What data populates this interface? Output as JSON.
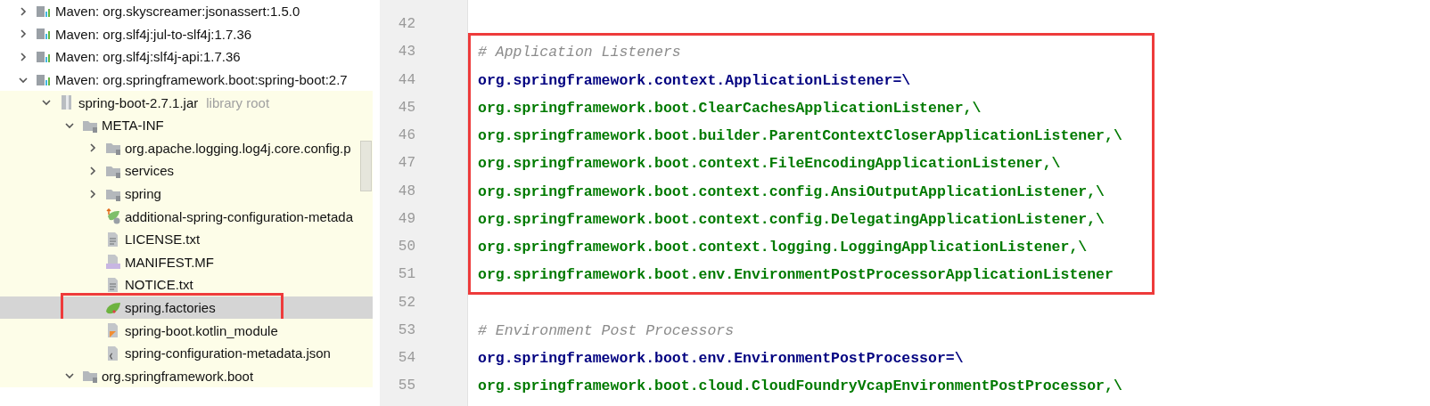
{
  "project_tree": [
    {
      "label": "Maven: org.skyscreamer:jsonassert:1.5.0",
      "kind": "maven",
      "expanded": false
    },
    {
      "label": "Maven: org.slf4j:jul-to-slf4j:1.7.36",
      "kind": "maven",
      "expanded": false
    },
    {
      "label": "Maven: org.slf4j:slf4j-api:1.7.36",
      "kind": "maven",
      "expanded": false
    },
    {
      "label": "Maven: org.springframework.boot:spring-boot:2.7",
      "kind": "maven",
      "expanded": true,
      "children": [
        {
          "label": "spring-boot-2.7.1.jar",
          "hint": "library root",
          "kind": "jar",
          "expanded": true,
          "scoped": true,
          "children": [
            {
              "label": "META-INF",
              "kind": "folder",
              "expanded": true,
              "children": [
                {
                  "label": "org.apache.logging.log4j.core.config.p",
                  "kind": "folder",
                  "expanded": false
                },
                {
                  "label": "services",
                  "kind": "folder",
                  "expanded": false
                },
                {
                  "label": "spring",
                  "kind": "folder",
                  "expanded": false
                },
                {
                  "label": "additional-spring-configuration-metada",
                  "kind": "meta",
                  "selected": false,
                  "annotated": false
                },
                {
                  "label": "LICENSE.txt",
                  "kind": "text",
                  "selected": false,
                  "annotated": false
                },
                {
                  "label": "MANIFEST.MF",
                  "kind": "manifest",
                  "selected": false,
                  "annotated": false
                },
                {
                  "label": "NOTICE.txt",
                  "kind": "text",
                  "selected": false,
                  "annotated": false
                },
                {
                  "label": "spring.factories",
                  "kind": "spring",
                  "selected": true,
                  "annotated": true
                },
                {
                  "label": "spring-boot.kotlin_module",
                  "kind": "kotlin",
                  "selected": false,
                  "annotated": false
                },
                {
                  "label": "spring-configuration-metadata.json",
                  "kind": "json",
                  "selected": false,
                  "annotated": false
                }
              ]
            },
            {
              "label": "org.springframework.boot",
              "kind": "folder",
              "expanded": true
            }
          ]
        }
      ]
    }
  ],
  "editor": {
    "blocks": [
      {
        "boxed": false,
        "lines": [
          {
            "number": "42",
            "kind": "blank"
          }
        ]
      },
      {
        "boxed": true,
        "lines": [
          {
            "number": "43",
            "kind": "comment",
            "text": "# Application Listeners"
          },
          {
            "number": "44",
            "kind": "key",
            "text": "org.springframework.context.ApplicationListener=\\"
          },
          {
            "number": "45",
            "kind": "value",
            "text": "org.springframework.boot.ClearCachesApplicationListener,\\"
          },
          {
            "number": "46",
            "kind": "value",
            "text": "org.springframework.boot.builder.ParentContextCloserApplicationListener,\\"
          },
          {
            "number": "47",
            "kind": "value",
            "text": "org.springframework.boot.context.FileEncodingApplicationListener,\\"
          },
          {
            "number": "48",
            "kind": "value",
            "text": "org.springframework.boot.context.config.AnsiOutputApplicationListener,\\"
          },
          {
            "number": "49",
            "kind": "value",
            "text": "org.springframework.boot.context.config.DelegatingApplicationListener,\\"
          },
          {
            "number": "50",
            "kind": "value",
            "text": "org.springframework.boot.context.logging.LoggingApplicationListener,\\"
          },
          {
            "number": "51",
            "kind": "value",
            "text": "org.springframework.boot.env.EnvironmentPostProcessorApplicationListener"
          }
        ]
      },
      {
        "boxed": false,
        "lines": [
          {
            "number": "52",
            "kind": "blank"
          },
          {
            "number": "53",
            "kind": "comment",
            "text": "# Environment Post Processors"
          },
          {
            "number": "54",
            "kind": "key",
            "text": "org.springframework.boot.env.EnvironmentPostProcessor=\\"
          },
          {
            "number": "55",
            "kind": "value",
            "text": "org.springframework.boot.cloud.CloudFoundryVcapEnvironmentPostProcessor,\\"
          }
        ]
      }
    ]
  }
}
